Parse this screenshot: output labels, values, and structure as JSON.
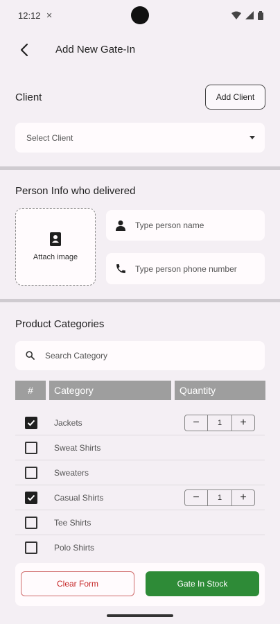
{
  "status_bar": {
    "time": "12:12"
  },
  "app_bar": {
    "title": "Add New Gate-In"
  },
  "client": {
    "section_title": "Client",
    "add_button": "Add Client",
    "select_placeholder": "Select Client"
  },
  "person": {
    "section_title": "Person Info who delivered",
    "attach_label": "Attach image",
    "name_placeholder": "Type person name",
    "phone_placeholder": "Type person phone number"
  },
  "products": {
    "section_title": "Product Categories",
    "search_placeholder": "Search Category",
    "columns": [
      "#",
      "Category",
      "Quantity"
    ],
    "rows": [
      {
        "label": "Jackets",
        "checked": true,
        "quantity": "1"
      },
      {
        "label": "Sweat Shirts",
        "checked": false
      },
      {
        "label": "Sweaters",
        "checked": false
      },
      {
        "label": "Casual Shirts",
        "checked": true,
        "quantity": "1"
      },
      {
        "label": "Tee Shirts",
        "checked": false
      },
      {
        "label": "Polo Shirts",
        "checked": false
      }
    ]
  },
  "actions": {
    "clear_label": "Clear Form",
    "submit_label": "Gate In Stock"
  },
  "colors": {
    "background": "#f4eff4",
    "accent_green": "#2e8b37",
    "danger_red": "#c62828",
    "table_header": "#9e9e9e"
  }
}
